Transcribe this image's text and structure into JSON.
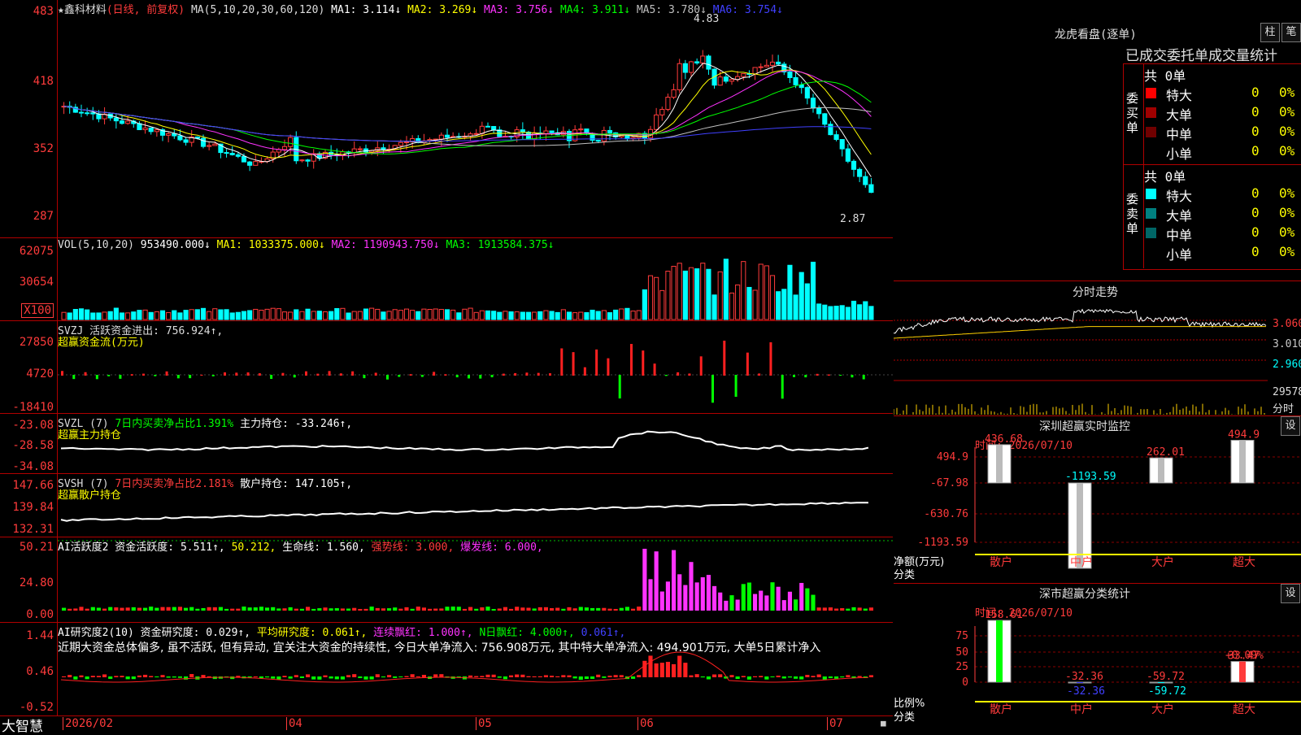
{
  "stock": {
    "name": "★鑫科材料",
    "mode": "(日线, 前复权)"
  },
  "price_panel": {
    "ma_header": "MA(5,10,20,30,60,120)",
    "ma": [
      {
        "label": "MA1: 3.114↓",
        "color": "#ffffff"
      },
      {
        "label": "MA2: 3.269↓",
        "color": "#ffff00"
      },
      {
        "label": "MA3: 3.756↓",
        "color": "#ff33ff"
      },
      {
        "label": "MA4: 3.911↓",
        "color": "#00ff00"
      },
      {
        "label": "MA5: 3.780↓",
        "color": "#c0c0c0"
      },
      {
        "label": "MA6: 3.754↓",
        "color": "#4040ff"
      }
    ],
    "ticks": [
      "483",
      "418",
      "352",
      "287"
    ],
    "high_label": "4.83",
    "low_label": "2.87"
  },
  "vol_panel": {
    "header": "VOL(5,10,20)",
    "v": "953490.000↓",
    "ma1": "MA1: 1033375.000↓",
    "ma2": "MA2: 1190943.750↓",
    "ma3": "MA3: 1913584.375↓",
    "ticks": [
      "62075",
      "30654"
    ],
    "unit": "X100"
  },
  "svzj_panel": {
    "header": "SVZJ  活跃资金进出: 756.924↑,",
    "sub": "超赢资金流(万元)",
    "ticks": [
      "27850",
      "4720",
      "-18410"
    ]
  },
  "svzl_panel": {
    "header_a": "SVZL (7)",
    "header_b": "7日内买卖净占比1.391%",
    "header_c": "主力持仓: -33.246↑,",
    "sub": "超赢主力持仓",
    "ticks": [
      "-23.08",
      "-28.58",
      "-34.08"
    ]
  },
  "svsh_panel": {
    "header_a": "SVSH (7)",
    "header_b": "7日内买卖净占比2.181%",
    "header_c": "散户持仓: 147.105↑,",
    "sub": "超赢散户持仓",
    "ticks": [
      "147.66",
      "139.84",
      "132.31"
    ]
  },
  "ai_act_panel": {
    "h1": "AI活跃度2 资金活跃度: 5.511↑,",
    "h2": "50.212,",
    "h3": "生命线: 1.560,",
    "h4": "强势线: 3.000,",
    "h5": "爆发线: 6.000,",
    "ticks": [
      "50.21",
      "24.80",
      "0.00"
    ]
  },
  "ai_res_panel": {
    "h1": "AI研究度2(10) 资金研究度: 0.029↑,",
    "h2": "平均研究度: 0.061↑,",
    "h3": "连续飘红: 1.000↑,",
    "h4": "N日飘红: 4.000↑,",
    "h5": "0.061↑,",
    "text": "近期大资金总体偏多, 虽不活跃, 但有异动, 宜关注大资金的持续性, 今日大单净流入: 756.908万元, 其中特大单净流入: 494.901万元, 大单5日累计净入",
    "ticks": [
      "1.44",
      "0.46",
      "-0.52"
    ]
  },
  "x_axis": {
    "brand": "大智慧",
    "dates": [
      "2026/02",
      "04",
      "05",
      "06",
      "07"
    ]
  },
  "lhb": {
    "title": "龙虎看盘(逐单)",
    "btn_a": "柱",
    "btn_b": "笔",
    "heading": "已成交委托单成交量统计",
    "buy": {
      "side": "委买单",
      "total": "共 0单",
      "rows": [
        {
          "name": "特大",
          "v": "0",
          "p": "0%",
          "color": "#ff0000"
        },
        {
          "name": "大单",
          "v": "0",
          "p": "0%",
          "color": "#a00000"
        },
        {
          "name": "中单",
          "v": "0",
          "p": "0%",
          "color": "#700000"
        },
        {
          "name": "小单",
          "v": "0",
          "p": "0%",
          "color": ""
        }
      ]
    },
    "sell": {
      "side": "委卖单",
      "total": "共 0单",
      "rows": [
        {
          "name": "特大",
          "v": "0",
          "p": "0%",
          "color": "#00ffff"
        },
        {
          "name": "大单",
          "v": "0",
          "p": "0%",
          "color": "#008080"
        },
        {
          "name": "中单",
          "v": "0",
          "p": "0%",
          "color": "#006666"
        },
        {
          "name": "小单",
          "v": "0",
          "p": "0%",
          "color": ""
        }
      ]
    }
  },
  "intraday": {
    "title": "分时走势",
    "ticks": [
      "3.060",
      "3.010",
      "2.960"
    ],
    "vol_tick": "29578",
    "vol_label": "分时"
  },
  "sz_monitor": {
    "title": "深圳超赢实时监控",
    "btn": "设",
    "time": "时间: 2026/07/10",
    "ylabel": "净额(万元)",
    "xlabel": "分类",
    "ticks": [
      "494.9",
      "-67.98",
      "-630.76",
      "-1193.59"
    ],
    "bars": [
      {
        "cat": "散户",
        "value": 436.68
      },
      {
        "cat": "中户",
        "value": -1193.59
      },
      {
        "cat": "大户",
        "value": 262.01
      },
      {
        "cat": "超大",
        "value": 494.9
      }
    ]
  },
  "sz_stats": {
    "title": "深市超赢分类统计",
    "btn": "设",
    "time": "时间: 2026/07/10",
    "ylabel": "比例%",
    "xlabel": "分类",
    "ticks": [
      "75",
      "50",
      "25",
      "0"
    ],
    "badge": "+0.09%",
    "bars": [
      {
        "cat": "散户",
        "value": 158.61,
        "label": "158.61",
        "color": "#00ff00"
      },
      {
        "cat": "中户",
        "value": -32.36,
        "label": "-32.36",
        "color": "#4040ff"
      },
      {
        "cat": "大户",
        "value": -59.72,
        "label": "-59.72",
        "color": "#00ffff"
      },
      {
        "cat": "超大",
        "value": 33.47,
        "label": "33.47",
        "color": "#ff3b3b"
      }
    ]
  }
}
